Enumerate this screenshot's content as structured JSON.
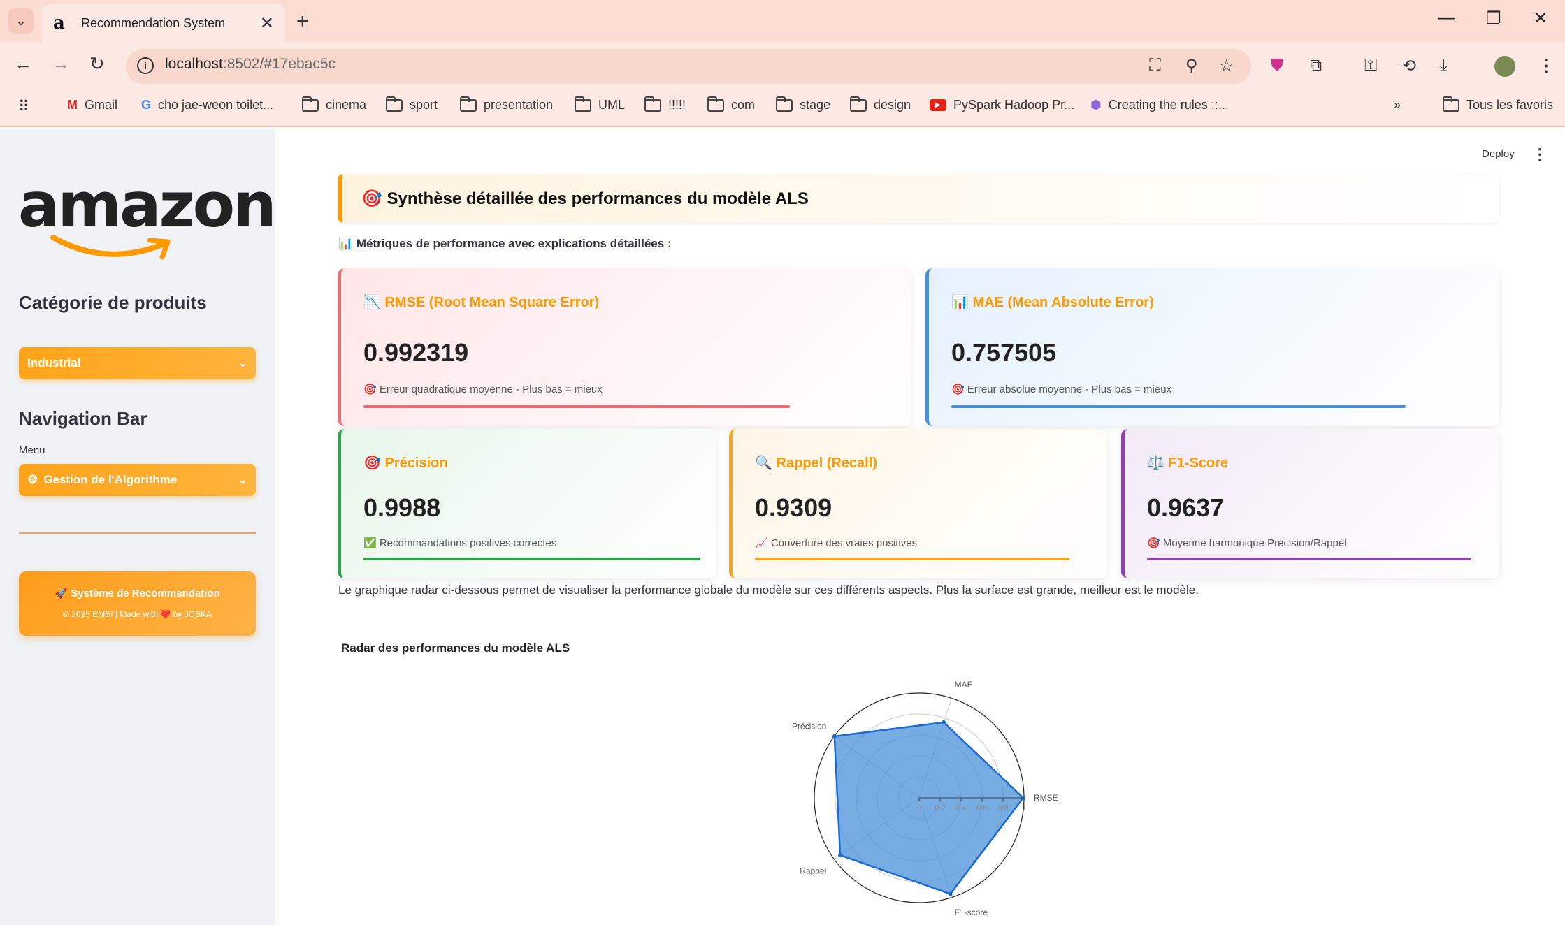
{
  "browser": {
    "tab_title": "Recommendation System",
    "url_host": "localhost",
    "url_rest": ":8502/#17ebac5c",
    "bookmarks": [
      {
        "label": "Gmail",
        "icon": "gmail-icon"
      },
      {
        "label": "cho jae-weon toilet...",
        "icon": "google-icon"
      },
      {
        "label": "cinema",
        "icon": "folder-icon"
      },
      {
        "label": "sport",
        "icon": "folder-icon"
      },
      {
        "label": "presentation",
        "icon": "folder-icon"
      },
      {
        "label": "UML",
        "icon": "folder-icon"
      },
      {
        "label": "!!!!!",
        "icon": "folder-icon"
      },
      {
        "label": "com",
        "icon": "folder-icon"
      },
      {
        "label": "stage",
        "icon": "folder-icon"
      },
      {
        "label": "design",
        "icon": "folder-icon"
      },
      {
        "label": "PySpark Hadoop Pr...",
        "icon": "youtube-icon"
      },
      {
        "label": "Creating the rules ::...",
        "icon": "cube-icon"
      }
    ],
    "all_bookmarks": "Tous les favoris"
  },
  "sidebar": {
    "logo_text": "amazon",
    "category_heading": "Catégorie de produits",
    "category_value": "Industrial",
    "nav_heading": "Navigation Bar",
    "menu_label": "Menu",
    "menu_value": "Gestion de l'Algorithme",
    "footer_title": "🚀 Système de Recommandation",
    "footer_sub": "© 2025 EMSI | Made with ❤️ by JOSKA"
  },
  "main": {
    "deploy": "Deploy",
    "header": "🎯 Synthèse détaillée des performances du modèle ALS",
    "subheading": "📊 Métriques de performance avec explications détaillées :",
    "cards": {
      "rmse": {
        "title": "📉 RMSE (Root Mean Square Error)",
        "value": "0.992319",
        "desc": "🎯 Erreur quadratique moyenne - Plus bas = mieux",
        "color": "#ef6b73"
      },
      "mae": {
        "title": "📊 MAE (Mean Absolute Error)",
        "value": "0.757505",
        "desc": "🎯 Erreur absolue moyenne - Plus bas = mieux",
        "color": "#4a90d9"
      },
      "precision": {
        "title": "🎯 Précision",
        "value": "0.9988",
        "desc": "✅ Recommandations positives correctes",
        "color": "#2ea44f"
      },
      "recall": {
        "title": "🔍 Rappel (Recall)",
        "value": "0.9309",
        "desc": "📈 Couverture des vraies positives",
        "color": "#f5a623"
      },
      "f1": {
        "title": "⚖️ F1-Score",
        "value": "0.9637",
        "desc": "🎯 Moyenne harmonique Précision/Rappel",
        "color": "#8e44ad"
      }
    },
    "radar_note": "Le graphique radar ci-dessous permet de visualiser la performance globale du modèle sur ces différents aspects. Plus la surface est grande, meilleur est le modèle.",
    "radar_title": "Radar des performances du modèle ALS"
  },
  "chart_data": {
    "type": "radar",
    "title": "Radar des performances du modèle ALS",
    "axes": [
      "RMSE",
      "MAE",
      "Précision",
      "Rappel",
      "F1-score"
    ],
    "values": [
      0.992319,
      0.757505,
      0.9988,
      0.9309,
      0.9637
    ],
    "rlim": [
      0,
      1
    ],
    "rticks": [
      "0",
      "0.2",
      "0.4",
      "0.6",
      "0.8",
      "1"
    ],
    "fill_color": "#4a90d9",
    "line_color": "#1a6bd1"
  }
}
